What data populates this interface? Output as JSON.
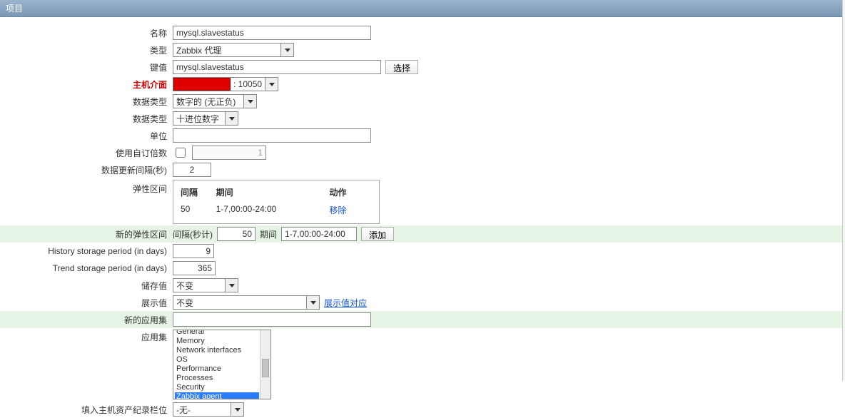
{
  "title": "项目",
  "labels": {
    "name": "名称",
    "type": "类型",
    "key": "键值",
    "hostif": "主机介面",
    "info_type": "数据类型",
    "data_type": "数据类型",
    "units": "单位",
    "multiplier": "使用自订倍数",
    "interval": "数据更新间隔(秒)",
    "flex": "弹性区间",
    "newflex": "新的弹性区间",
    "history": "History storage period (in days)",
    "trend": "Trend storage period (in days)",
    "store": "储存值",
    "show": "展示值",
    "newapp": "新的应用集",
    "apps": "应用集",
    "inventory": "填入主机资产纪录栏位"
  },
  "fields": {
    "name_value": "mysql.slavestatus",
    "type_value": "Zabbix 代理",
    "key_value": "mysql.slavestatus",
    "select_btn": "选择",
    "hostif_port": ": 10050",
    "info_type_value": "数字的 (无正负)",
    "data_type_value": "十进位数字",
    "units_value": "",
    "multiplier_value": "1",
    "interval_value": "2",
    "history_value": "9",
    "trend_value": "365",
    "store_value": "不变",
    "show_value": "不变",
    "show_link": "展示值对应",
    "newapp_value": "",
    "inventory_value": "-无-"
  },
  "flex": {
    "hdr_interval": "间隔",
    "hdr_period": "期间",
    "hdr_action": "动作",
    "rows": [
      {
        "interval": "50",
        "period": "1-7,00:00-24:00",
        "action": "移除"
      }
    ]
  },
  "newflex": {
    "interval_label": "间隔(秒计)",
    "interval_value": "50",
    "period_label": "期间",
    "period_value": "1-7,00:00-24:00",
    "add_btn": "添加"
  },
  "apps_list": [
    "General",
    "Memory",
    "Network interfaces",
    "OS",
    "Performance",
    "Processes",
    "Security",
    "Zabbix agent"
  ],
  "apps_selected_index": 7
}
